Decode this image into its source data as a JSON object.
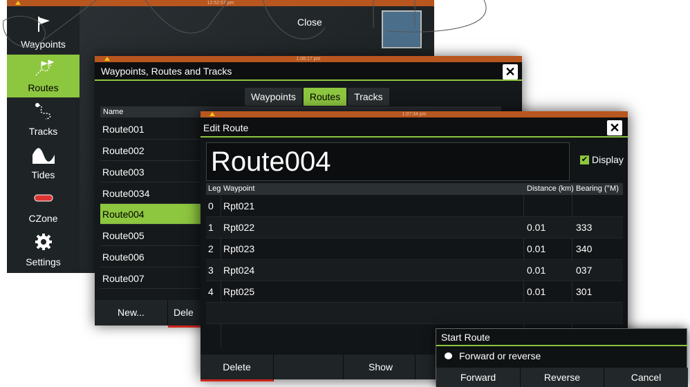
{
  "back_window": {
    "time": "12:52:57 pm",
    "close_label": "Close",
    "sidebar": [
      {
        "label": "Waypoints",
        "icon": "flag-icon",
        "active": false
      },
      {
        "label": "Routes",
        "icon": "route-flags-icon",
        "active": true
      },
      {
        "label": "Tracks",
        "icon": "track-icon",
        "active": false
      },
      {
        "label": "Tides",
        "icon": "tide-wave-icon",
        "active": false
      },
      {
        "label": "CZone",
        "icon": "czone-icon",
        "active": false
      },
      {
        "label": "Settings",
        "icon": "gear-icon",
        "active": false
      }
    ]
  },
  "list_window": {
    "time": "1:06:17 pm",
    "title": "Waypoints, Routes and Tracks",
    "tabs": [
      {
        "label": "Waypoints",
        "active": false
      },
      {
        "label": "Routes",
        "active": true
      },
      {
        "label": "Tracks",
        "active": false
      }
    ],
    "column_name": "Name",
    "routes": [
      "Route001",
      "Route002",
      "Route003",
      "Route0034",
      "Route004",
      "Route005",
      "Route006",
      "Route007"
    ],
    "selected": "Route004",
    "buttons": {
      "new": "New...",
      "delete": "Dele"
    }
  },
  "edit_window": {
    "time": "1:07:34 pm",
    "title": "Edit Route",
    "route_name": "Route004",
    "display_label": "Display",
    "columns": {
      "leg": "Leg",
      "waypoint": "Waypoint",
      "distance": "Distance (km)",
      "bearing": "Bearing (°M)"
    },
    "rows": [
      {
        "leg": "0",
        "waypoint": "Rpt021",
        "distance": "",
        "bearing": ""
      },
      {
        "leg": "1",
        "waypoint": "Rpt022",
        "distance": "0.01",
        "bearing": "333"
      },
      {
        "leg": "2",
        "waypoint": "Rpt023",
        "distance": "0.01",
        "bearing": "340"
      },
      {
        "leg": "3",
        "waypoint": "Rpt024",
        "distance": "0.01",
        "bearing": "037"
      },
      {
        "leg": "4",
        "waypoint": "Rpt025",
        "distance": "0.01",
        "bearing": "301"
      }
    ],
    "buttons": {
      "delete": "Delete",
      "show": "Show"
    }
  },
  "start_dialog": {
    "title": "Start Route",
    "message": "Forward or reverse",
    "buttons": {
      "forward": "Forward",
      "reverse": "Reverse",
      "cancel": "Cancel"
    }
  },
  "colors": {
    "accent": "#8dc63f",
    "titlebar": "#b8561f",
    "delete_red": "#d0251c"
  }
}
